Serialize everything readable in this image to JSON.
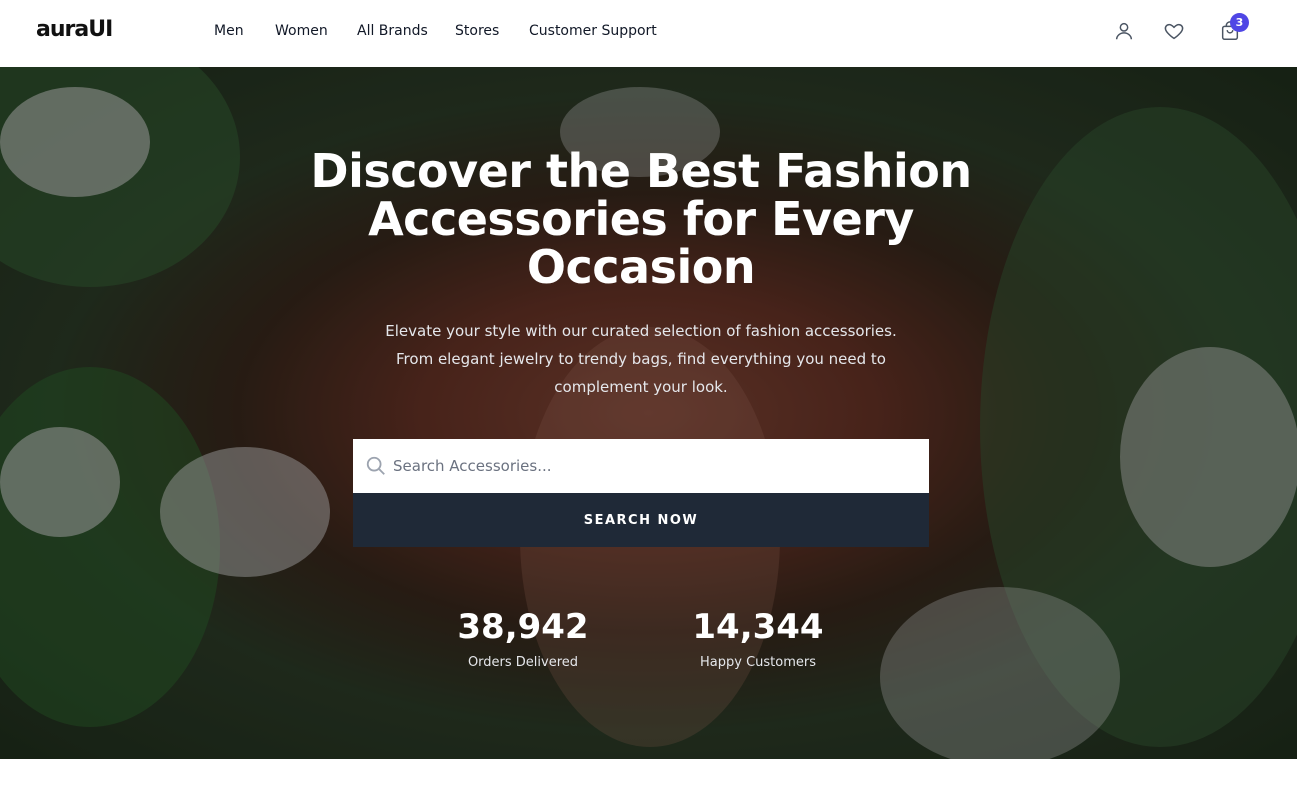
{
  "header": {
    "logo": "auraUI",
    "nav": [
      "Men",
      "Women",
      "All Brands",
      "Stores",
      "Customer Support"
    ],
    "cart_count": "3",
    "icons": [
      "user-icon",
      "heart-icon",
      "shopping-bag-icon"
    ]
  },
  "hero": {
    "title": "Discover the Best Fashion Accessories for Every Occasion",
    "subtitle": "Elevate your style with our curated selection of fashion accessories. From elegant jewelry to trendy bags, find everything you need to complement your look.",
    "search_placeholder": "Search Accessories...",
    "search_button": "SEARCH NOW",
    "stats": [
      {
        "value": "38,942",
        "label": "Orders Delivered"
      },
      {
        "value": "14,344",
        "label": "Happy Customers"
      }
    ]
  },
  "colors": {
    "accent": "#4f46e5",
    "button_bg": "#1f2937"
  }
}
